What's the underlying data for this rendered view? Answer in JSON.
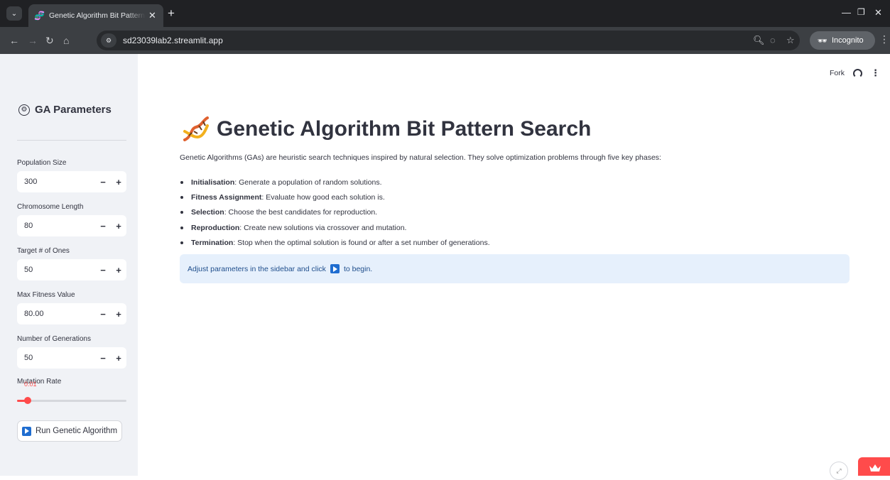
{
  "browser": {
    "tab_title": "Genetic Algorithm Bit Pattern S",
    "url": "sd23039lab2.streamlit.app",
    "incognito_label": "Incognito"
  },
  "sidebar": {
    "title": "GA Parameters",
    "fields": [
      {
        "label": "Population Size",
        "value": "300"
      },
      {
        "label": "Chromosome Length",
        "value": "80"
      },
      {
        "label": "Target # of Ones",
        "value": "50"
      },
      {
        "label": "Max Fitness Value",
        "value": "80.00"
      },
      {
        "label": "Number of Generations",
        "value": "50"
      }
    ],
    "mutation": {
      "label": "Mutation Rate",
      "value_text": "0.01",
      "fraction": 0.1
    },
    "run_button_label": "Run Genetic Algorithm"
  },
  "header": {
    "fork_label": "Fork"
  },
  "main": {
    "title": "Genetic Algorithm Bit Pattern Search",
    "intro": "Genetic Algorithms (GAs) are heuristic search techniques inspired by natural selection. They solve optimization problems through five key phases:",
    "phases": [
      {
        "name": "Initialisation",
        "desc": ": Generate a population of random solutions."
      },
      {
        "name": "Fitness Assignment",
        "desc": ": Evaluate how good each solution is."
      },
      {
        "name": "Selection",
        "desc": ": Choose the best candidates for reproduction."
      },
      {
        "name": "Reproduction",
        "desc": ": Create new solutions via crossover and mutation."
      },
      {
        "name": "Termination",
        "desc": ": Stop when the optimal solution is found or after a set number of generations."
      }
    ],
    "info_before": "Adjust parameters in the sidebar and click",
    "info_after": "to begin."
  },
  "colors": {
    "accent": "#ff4b4b",
    "info_bg": "#e6f0fc",
    "sidebar_bg": "#f0f2f6"
  }
}
